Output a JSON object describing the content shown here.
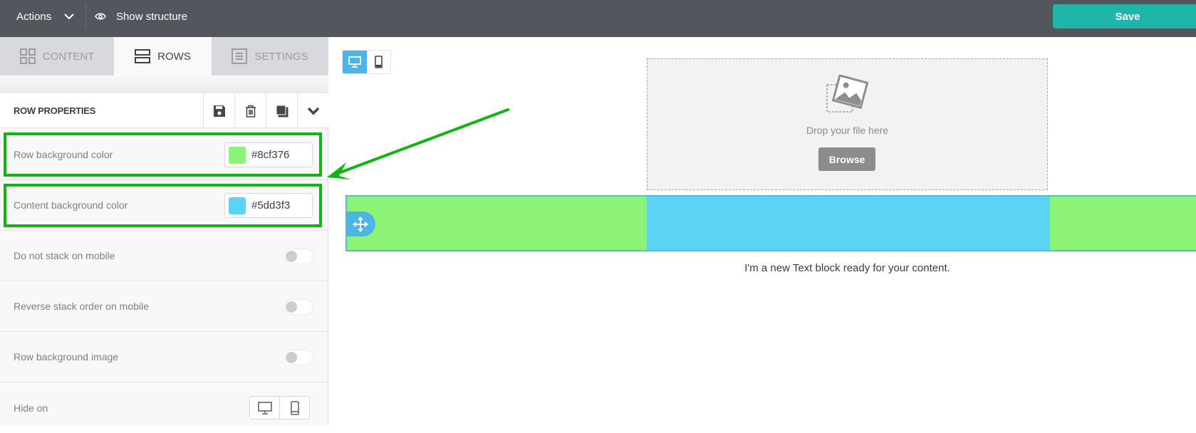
{
  "topbar": {
    "actions_label": "Actions",
    "show_structure_label": "Show structure",
    "save_label": "Save"
  },
  "tabs": [
    {
      "label": "CONTENT",
      "icon": "grid-icon",
      "active": false
    },
    {
      "label": "ROWS",
      "icon": "rows-icon",
      "active": true
    },
    {
      "label": "SETTINGS",
      "icon": "settings-doc-icon",
      "active": false
    }
  ],
  "row_properties": {
    "title": "ROW PROPERTIES",
    "tools": [
      "save-icon",
      "trash-icon",
      "duplicate-icon",
      "chevron-down-icon"
    ],
    "row_background": {
      "label": "Row background color",
      "value": "#8cf376",
      "color": "#8cf376",
      "highlighted": true
    },
    "content_background": {
      "label": "Content background color",
      "value": "#5dd3f3",
      "color": "#5dd3f3",
      "highlighted": true
    },
    "toggles": [
      {
        "label": "Do not stack on mobile",
        "on": false
      },
      {
        "label": "Reverse stack order on mobile",
        "on": false
      },
      {
        "label": "Row background image",
        "on": false
      }
    ],
    "hide_on": {
      "label": "Hide on",
      "options": [
        "desktop-icon",
        "mobile-icon"
      ]
    }
  },
  "canvas": {
    "device_view": {
      "options": [
        "desktop",
        "mobile"
      ],
      "selected": "desktop"
    },
    "image_block": {
      "drop_text": "Drop your file here",
      "browse_label": "Browse"
    },
    "row": {
      "row_color": "#8cf376",
      "content_color": "#5dd3f3"
    },
    "text_block": "I'm a new Text block ready for your content."
  },
  "annotation": {
    "color": "#11b411",
    "type": "arrow-and-boxes"
  },
  "colors": {
    "topbar": "#53575d",
    "save": "#1fb5ab",
    "accent_blue": "#4cb4e7"
  }
}
